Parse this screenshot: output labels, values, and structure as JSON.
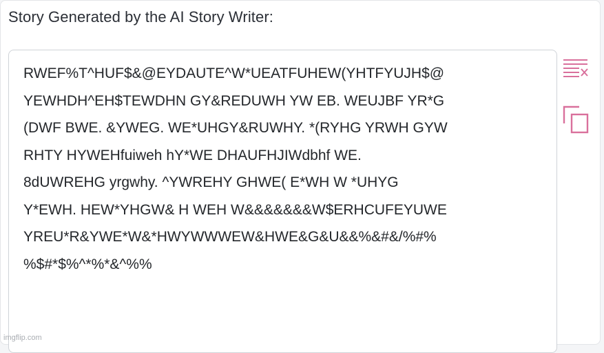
{
  "header": {
    "title": "Story Generated by the AI Story Writer:"
  },
  "story": {
    "lines": [
      "RWEF%T^HUF$&@EYDAUTE^W*UEATFUHEW(YHTFYUJH$@",
      "YEWHDH^EH$TEWDHN GY&REDUWH YW EB. WEUJBF YR*G",
      "(DWF BWE. &YWEG. WE*UHGY&RUWHY. *(RYHG YRWH GYW",
      "RHTY HYWEHfuiweh hY*WE DHAUFHJIWdbhf WE.",
      "8dUWREHG yrgwhy. ^YWREHY GHWE( E*WH W *UHYG",
      "Y*EWH. HEW*YHGW& H WEH W&&&&&&&W$ERHCUFEYUWE",
      "YREU*R&YWE*W&*HWYWWWEW&HWE&G&U&&%&#&/%#%",
      "%$#*$%^*%*&^%%"
    ]
  },
  "toolbar": {
    "clear_icon": "clear-text-icon",
    "copy_icon": "copy-icon",
    "accent_color": "#d9709c"
  },
  "watermark": {
    "text": "imgflip.com"
  }
}
